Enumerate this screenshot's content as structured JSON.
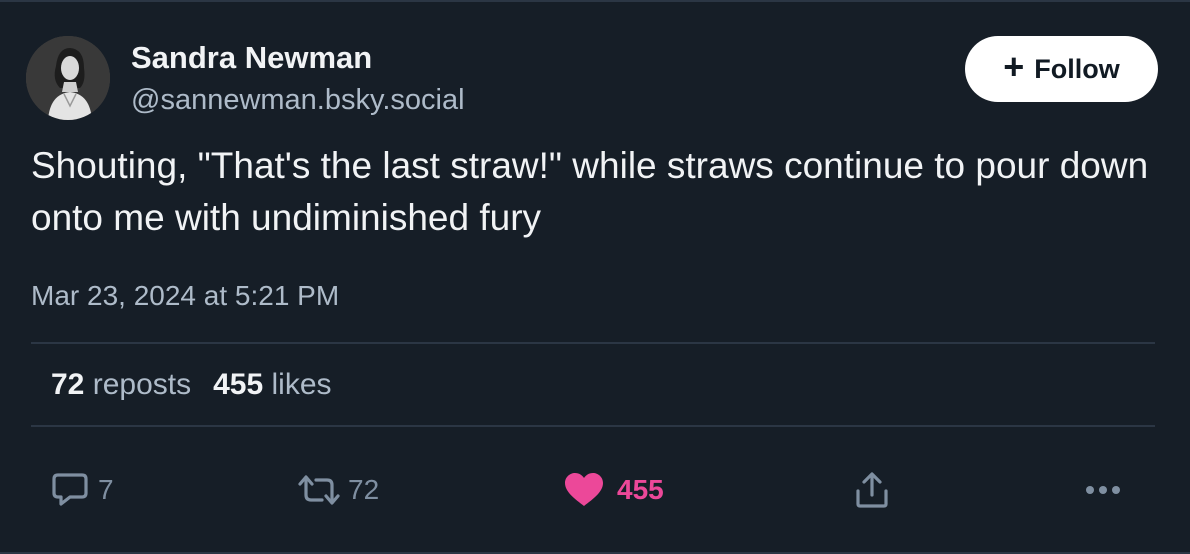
{
  "author": {
    "display_name": "Sandra Newman",
    "handle": "@sannewman.bsky.social"
  },
  "follow_button": {
    "label": "Follow",
    "icon": "plus-icon"
  },
  "post": {
    "text": "Shouting, \"That's the last straw!\" while straws continue to pour down onto me with undiminished fury",
    "timestamp": "Mar 23, 2024 at 5:21 PM"
  },
  "stats": {
    "reposts_count": "72",
    "reposts_label": "reposts",
    "likes_count": "455",
    "likes_label": "likes"
  },
  "actions": {
    "reply": {
      "icon": "reply-bubble-icon",
      "count": "7"
    },
    "repost": {
      "icon": "repost-arrows-icon",
      "count": "72"
    },
    "like": {
      "icon": "heart-icon",
      "count": "455",
      "liked": true
    },
    "share": {
      "icon": "share-icon"
    },
    "more": {
      "icon": "more-dots-icon"
    }
  },
  "colors": {
    "background": "#161e27",
    "like_active": "#ec4899",
    "muted": "#aebbc9",
    "divider": "#2b3644"
  }
}
